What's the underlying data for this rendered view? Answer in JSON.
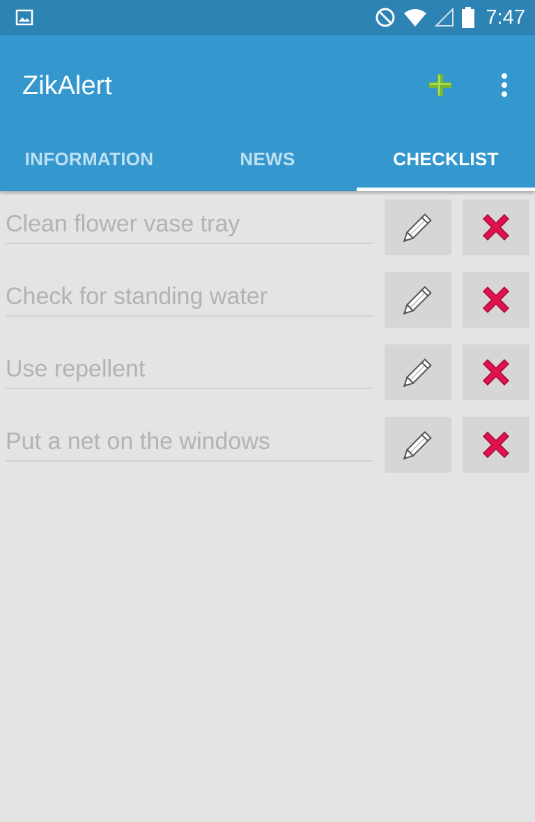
{
  "status_bar": {
    "time": "7:47",
    "icons": [
      "image-notification-icon",
      "do-not-disturb-icon",
      "wifi-icon",
      "signal-icon",
      "battery-icon"
    ]
  },
  "app_bar": {
    "title": "ZikAlert",
    "add_icon": "plus-icon",
    "add_color": "#8cc63f",
    "overflow_icon": "more-vertical-icon",
    "background": "#3498cf"
  },
  "tabs": [
    {
      "label": "INFORMATION",
      "active": false
    },
    {
      "label": "NEWS",
      "active": false
    },
    {
      "label": "CHECKLIST",
      "active": true
    }
  ],
  "checklist": {
    "items": [
      {
        "text": "Clean flower vase tray"
      },
      {
        "text": "Check for standing water"
      },
      {
        "text": "Use repellent"
      },
      {
        "text": "Put a net on the windows"
      }
    ],
    "edit_icon": "pencil-icon",
    "delete_icon": "red-x-icon",
    "delete_color": "#e0124f"
  }
}
